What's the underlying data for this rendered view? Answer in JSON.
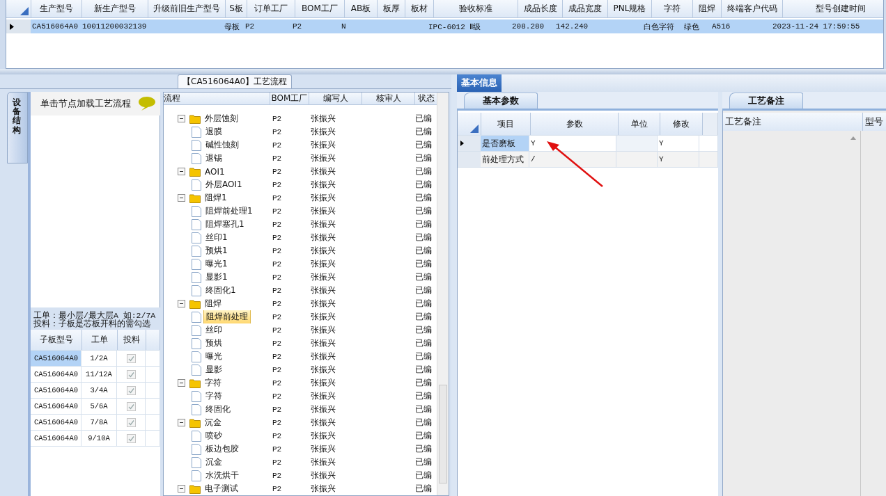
{
  "main_grid": {
    "columns": [
      "生产型号",
      "新生产型号",
      "升级前旧生产型号",
      "S板",
      "订单工厂",
      "BOM工厂",
      "AB板",
      "板厚",
      "板材",
      "验收标准",
      "成品长度",
      "成品宽度",
      "PNL规格",
      "字符",
      "阻焊",
      "终端客户代码",
      "型号创建时间"
    ],
    "rows": [
      {
        "selected": true,
        "cells": [
          "CA516064A0",
          "10011200032139",
          null,
          "母板",
          "P2",
          "P2",
          "N",
          null,
          null,
          "IPC-6012 Ⅱ级",
          "208.280",
          "142.240",
          null,
          "白色字符",
          "绿色",
          "A516",
          "2023-11-24 17:59:55"
        ]
      }
    ]
  },
  "process_tab": {
    "label": "【CA516064A0】工艺流程"
  },
  "side_tab": {
    "label": "设备结构"
  },
  "hint": "单击节点加载工艺流程",
  "notes": [
    "工单：最小层/最大层A 如:2/7A",
    "投料：子板是芯板开料的需勾选"
  ],
  "sub_grid": {
    "columns": [
      "子板型号",
      "工单",
      "投料"
    ],
    "rows": [
      {
        "model": "CA516064A0",
        "order": "1/2A",
        "checked": true,
        "selected": true
      },
      {
        "model": "CA516064A0",
        "order": "11/12A",
        "checked": true,
        "selected": false
      },
      {
        "model": "CA516064A0",
        "order": "3/4A",
        "checked": true,
        "selected": false
      },
      {
        "model": "CA516064A0",
        "order": "5/6A",
        "checked": true,
        "selected": false
      },
      {
        "model": "CA516064A0",
        "order": "7/8A",
        "checked": true,
        "selected": false
      },
      {
        "model": "CA516064A0",
        "order": "9/10A",
        "checked": true,
        "selected": false
      }
    ]
  },
  "process_tree": {
    "columns": [
      "流程",
      "BOM工厂",
      "编写人",
      "核审人",
      "状态"
    ],
    "nodes": [
      {
        "name": "外层蚀刻",
        "bom": "P2",
        "writer": "张振兴",
        "status": "已编",
        "expanded": true,
        "selected": false,
        "children": [
          {
            "name": "退膜",
            "bom": "P2",
            "writer": "张振兴",
            "status": "已编",
            "selected": false
          },
          {
            "name": "碱性蚀刻",
            "bom": "P2",
            "writer": "张振兴",
            "status": "已编",
            "selected": false
          },
          {
            "name": "退锡",
            "bom": "P2",
            "writer": "张振兴",
            "status": "已编",
            "selected": false
          }
        ]
      },
      {
        "name": "AOI1",
        "bom": "P2",
        "writer": "张振兴",
        "status": "已编",
        "expanded": true,
        "selected": false,
        "children": [
          {
            "name": "外层AOI1",
            "bom": "P2",
            "writer": "张振兴",
            "status": "已编",
            "selected": false
          }
        ]
      },
      {
        "name": "阻焊1",
        "bom": "P2",
        "writer": "张振兴",
        "status": "已编",
        "expanded": true,
        "selected": false,
        "children": [
          {
            "name": "阻焊前处理1",
            "bom": "P2",
            "writer": "张振兴",
            "status": "已编",
            "selected": false
          },
          {
            "name": "阻焊塞孔1",
            "bom": "P2",
            "writer": "张振兴",
            "status": "已编",
            "selected": false
          },
          {
            "name": "丝印1",
            "bom": "P2",
            "writer": "张振兴",
            "status": "已编",
            "selected": false
          },
          {
            "name": "预烘1",
            "bom": "P2",
            "writer": "张振兴",
            "status": "已编",
            "selected": false
          },
          {
            "name": "曝光1",
            "bom": "P2",
            "writer": "张振兴",
            "status": "已编",
            "selected": false
          },
          {
            "name": "显影1",
            "bom": "P2",
            "writer": "张振兴",
            "status": "已编",
            "selected": false
          },
          {
            "name": "终固化1",
            "bom": "P2",
            "writer": "张振兴",
            "status": "已编",
            "selected": false
          }
        ]
      },
      {
        "name": "阻焊",
        "bom": "P2",
        "writer": "张振兴",
        "status": "已编",
        "expanded": true,
        "selected": false,
        "children": [
          {
            "name": "阻焊前处理",
            "bom": "P2",
            "writer": "张振兴",
            "status": "已编",
            "selected": true
          },
          {
            "name": "丝印",
            "bom": "P2",
            "writer": "张振兴",
            "status": "已编",
            "selected": false
          },
          {
            "name": "预烘",
            "bom": "P2",
            "writer": "张振兴",
            "status": "已编",
            "selected": false
          },
          {
            "name": "曝光",
            "bom": "P2",
            "writer": "张振兴",
            "status": "已编",
            "selected": false
          },
          {
            "name": "显影",
            "bom": "P2",
            "writer": "张振兴",
            "status": "已编",
            "selected": false
          }
        ]
      },
      {
        "name": "字符",
        "bom": "P2",
        "writer": "张振兴",
        "status": "已编",
        "expanded": true,
        "selected": false,
        "children": [
          {
            "name": "字符",
            "bom": "P2",
            "writer": "张振兴",
            "status": "已编",
            "selected": false
          },
          {
            "name": "终固化",
            "bom": "P2",
            "writer": "张振兴",
            "status": "已编",
            "selected": false
          }
        ]
      },
      {
        "name": "沉金",
        "bom": "P2",
        "writer": "张振兴",
        "status": "已编",
        "expanded": true,
        "selected": false,
        "children": [
          {
            "name": "喷砂",
            "bom": "P2",
            "writer": "张振兴",
            "status": "已编",
            "selected": false
          },
          {
            "name": "板边包胶",
            "bom": "P2",
            "writer": "张振兴",
            "status": "已编",
            "selected": false
          },
          {
            "name": "沉金",
            "bom": "P2",
            "writer": "张振兴",
            "status": "已编",
            "selected": false
          },
          {
            "name": "水洗烘干",
            "bom": "P2",
            "writer": "张振兴",
            "status": "已编",
            "selected": false
          }
        ]
      },
      {
        "name": "电子测试",
        "bom": "P2",
        "writer": "张振兴",
        "status": "已编",
        "expanded": true,
        "selected": false
      }
    ]
  },
  "info_tab": {
    "label": "基本信息",
    "selected": true
  },
  "params": {
    "tab": "基本参数",
    "columns": [
      "项目",
      "参数",
      "单位",
      "修改"
    ],
    "rows": [
      {
        "item": "是否磨板",
        "value": "Y",
        "modify": "Y",
        "selected": true
      },
      {
        "item": "前处理方式",
        "value": "/",
        "modify": "Y",
        "selected": false
      }
    ]
  },
  "remarks": {
    "tab": "工艺备注",
    "columns": [
      "工艺备注",
      "型号"
    ]
  }
}
